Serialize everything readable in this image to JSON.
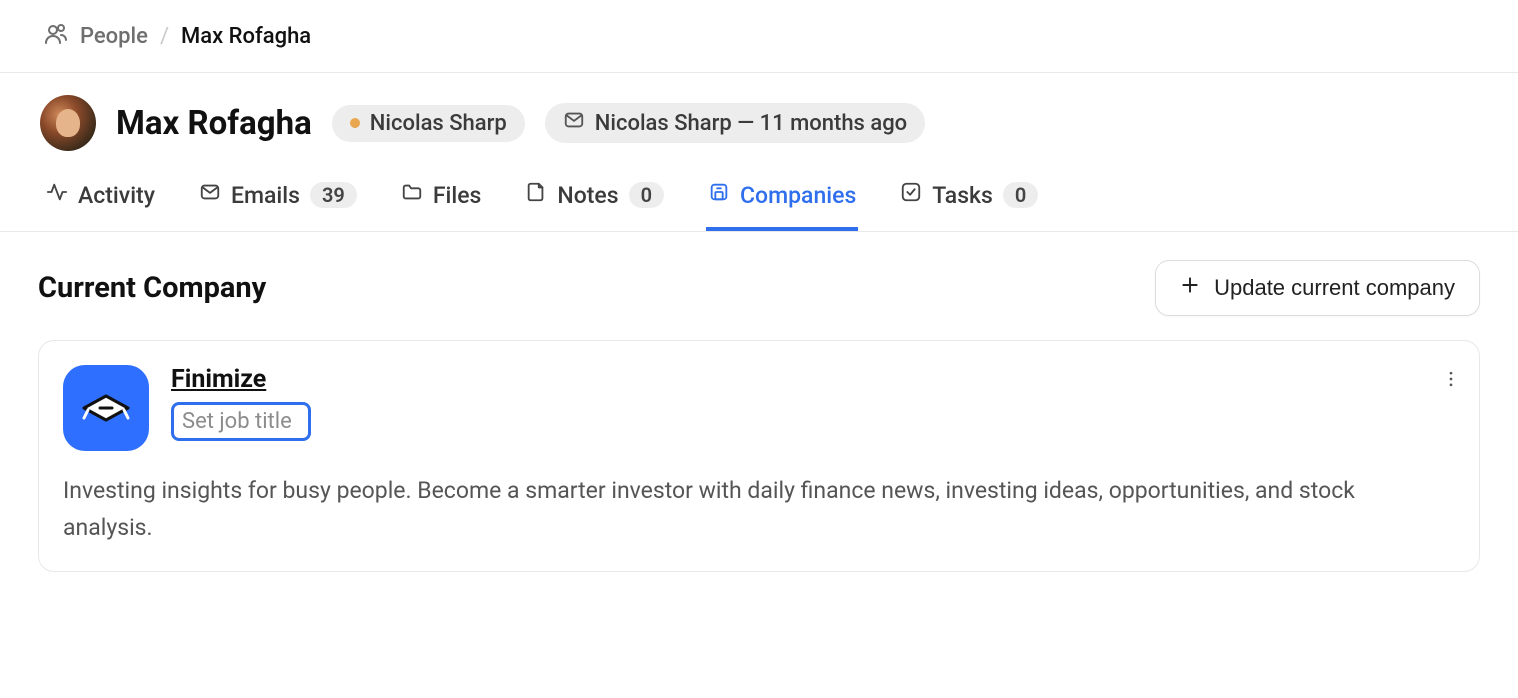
{
  "breadcrumb": {
    "section": "People",
    "current": "Max Rofagha"
  },
  "person": {
    "name": "Max Rofagha"
  },
  "chips": {
    "owner": "Nicolas Sharp",
    "last_contact": "Nicolas Sharp — 11 months ago"
  },
  "tabs": {
    "activity": "Activity",
    "emails": {
      "label": "Emails",
      "count": "39"
    },
    "files": "Files",
    "notes": {
      "label": "Notes",
      "count": "0"
    },
    "companies": "Companies",
    "tasks": {
      "label": "Tasks",
      "count": "0"
    }
  },
  "section": {
    "title": "Current Company",
    "update_button": "Update current company"
  },
  "company": {
    "name": "Finimize",
    "job_title_placeholder": "Set job title",
    "description": "Investing insights for busy people. Become a smarter investor with daily finance news, investing ideas, opportunities, and stock analysis."
  }
}
